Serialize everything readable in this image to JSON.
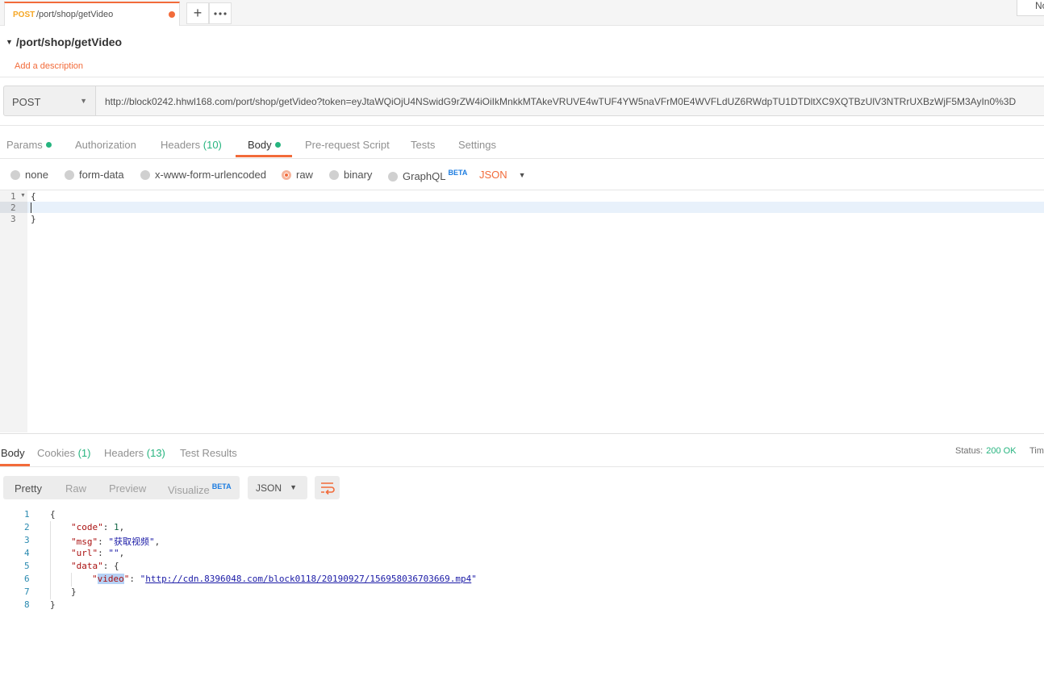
{
  "tab": {
    "method": "POST",
    "name": "/port/shop/getVideo",
    "unsaved_color": "#f26b3a"
  },
  "tab_actions": {
    "new_tab_icon": "plus-icon",
    "more_icon": "ellipsis-icon",
    "env_stub": "No"
  },
  "request": {
    "title": "/port/shop/getVideo",
    "add_description": "Add a description",
    "method": "POST",
    "url": "http://block0242.hhwl168.com/port/shop/getVideo?token=eyJtaWQiOjU4NSwidG9rZW4iOiIkMnkkMTAkeVRUVE4wTUF4YW5naVFrM0E4WVFLdUZ6RWdpTU1DTDltXC9XQTBzUlV3NTRrUXBzWjF5M3AyIn0%3D"
  },
  "request_tabs": {
    "params": "Params",
    "authorization": "Authorization",
    "headers": "Headers",
    "headers_count": "(10)",
    "body": "Body",
    "pre_request": "Pre-request Script",
    "tests": "Tests",
    "settings": "Settings"
  },
  "body_types": {
    "none": "none",
    "form_data": "form-data",
    "urlencoded": "x-www-form-urlencoded",
    "raw": "raw",
    "binary": "binary",
    "graphql": "GraphQL",
    "beta": "BETA",
    "format": "JSON"
  },
  "editor": {
    "line_numbers": [
      "1",
      "2",
      "3"
    ],
    "lines": [
      "{",
      "",
      "}"
    ]
  },
  "response_tabs": {
    "body": "Body",
    "cookies": "Cookies",
    "cookies_count": "(1)",
    "headers": "Headers",
    "headers_count": "(13)",
    "test_results": "Test Results",
    "status_label": "Status:",
    "status_value": "200 OK",
    "time_stub": "Tim"
  },
  "response_view": {
    "pretty": "Pretty",
    "raw": "Raw",
    "preview": "Preview",
    "visualize": "Visualize",
    "beta": "BETA",
    "format": "JSON",
    "wrap_icon": "wrap-lines-icon"
  },
  "response": {
    "line_numbers": [
      "1",
      "2",
      "3",
      "4",
      "5",
      "6",
      "7",
      "8"
    ],
    "open_brace": "{",
    "code_key": "\"code\"",
    "code_val": "1",
    "msg_key": "\"msg\"",
    "msg_val": "\"获取视频\"",
    "url_key": "\"url\"",
    "url_val": "\"\"",
    "data_key": "\"data\"",
    "video_key_quote_open": "\"",
    "video_key": "video",
    "video_key_quote_close": "\"",
    "video_val_quote": "\"",
    "video_url": "http://cdn.8396048.com/block0118/20190927/156958036703669.mp4",
    "inner_close": "}",
    "close_brace": "}"
  },
  "colors": {
    "accent": "#f26b3a",
    "success": "#26b47f",
    "method_post": "#f5a623",
    "beta": "#1c7ce0"
  }
}
